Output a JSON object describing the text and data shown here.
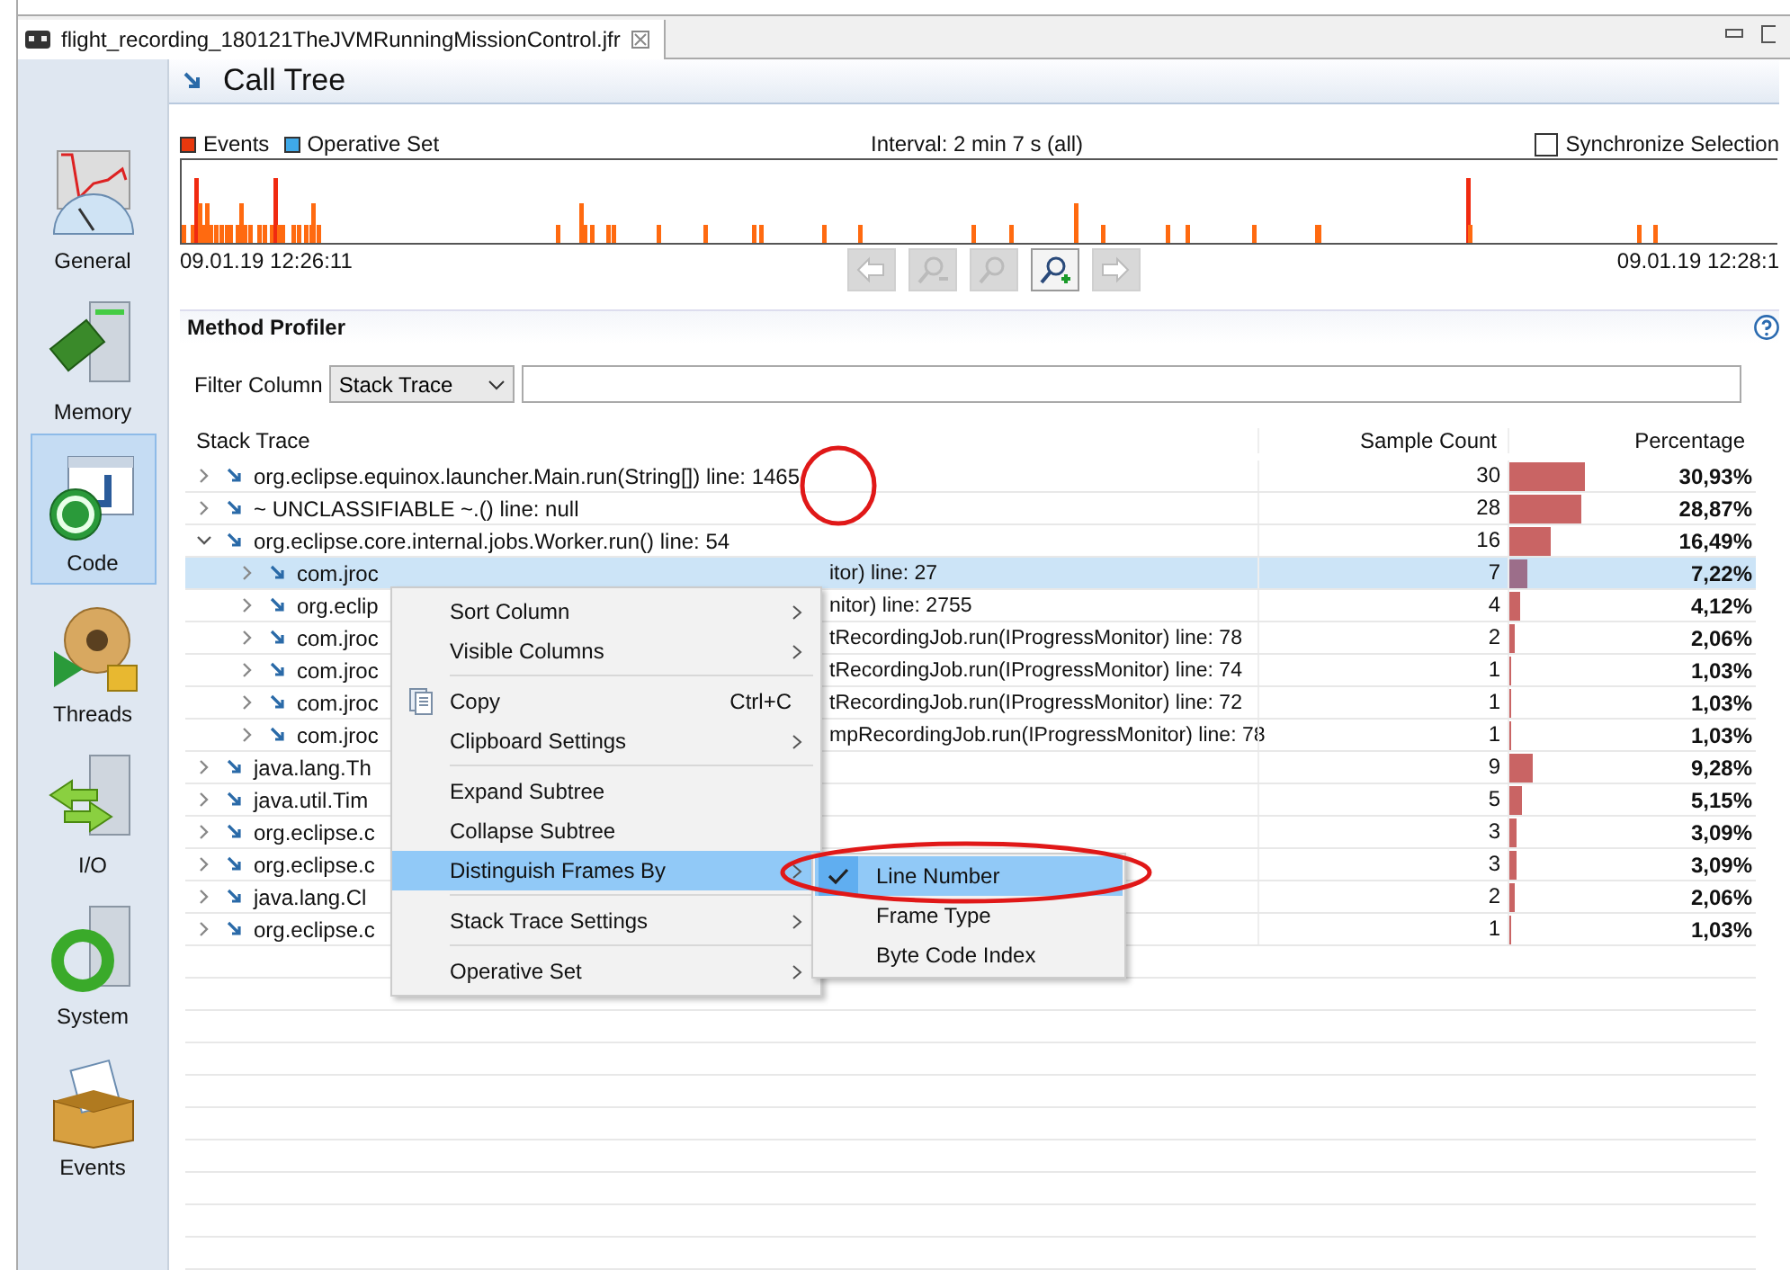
{
  "editor_tab": {
    "title": "flight_recording_180121TheJVMRunningMissionControl.jfr"
  },
  "sidebar": {
    "items": [
      {
        "label": "General",
        "selected": false
      },
      {
        "label": "Memory",
        "selected": false
      },
      {
        "label": "Code",
        "selected": true
      },
      {
        "label": "Threads",
        "selected": false
      },
      {
        "label": "I/O",
        "selected": false
      },
      {
        "label": "System",
        "selected": false
      },
      {
        "label": "Events",
        "selected": false
      }
    ]
  },
  "page": {
    "title": "Call Tree"
  },
  "timeline": {
    "legend": [
      {
        "label": "Events",
        "color": "#e8380d"
      },
      {
        "label": "Operative Set",
        "color": "#3fa9e8"
      }
    ],
    "interval": "Interval: 2 min 7 s (all)",
    "synchronize": {
      "label": "Synchronize Selection",
      "checked": false
    },
    "start_time": "09.01.19 12:26:11",
    "end_time": "09.01.19 12:28:1",
    "nav_buttons": [
      {
        "disabled": true
      },
      {
        "disabled": true
      },
      {
        "disabled": true
      },
      {
        "disabled": false
      },
      {
        "disabled": true
      }
    ]
  },
  "method_profiler": {
    "title": "Method Profiler",
    "filter_label": "Filter Column",
    "filter_value": "Stack Trace",
    "columns": [
      "Stack Trace",
      "Sample Count",
      "Percentage"
    ],
    "rows": [
      {
        "label": "org.eclipse.equinox.launcher.Main.run(String[]) line: 1465",
        "count": "30",
        "percentage": "30,93%",
        "level": 0.3093,
        "expanded": false,
        "selected": false
      },
      {
        "label": "~ UNCLASSIFIABLE ~.() line: null",
        "count": "28",
        "percentage": "28,87%",
        "level": 0.2887,
        "expanded": false,
        "selected": false
      },
      {
        "label": "org.eclipse.core.internal.jobs.Worker.run() line: 54",
        "count": "16",
        "percentage": "16,49%",
        "level": 0.1649,
        "expanded": true,
        "selected": false,
        "children": [
          {
            "label": "com.jroc",
            "tail": "itor) line: 27",
            "count": "7",
            "percentage": "7,22%",
            "level": 0.0722,
            "expanded": false,
            "selected": true
          },
          {
            "label": "org.eclip",
            "tail": "nitor) line: 2755",
            "count": "4",
            "percentage": "4,12%",
            "level": 0.0412,
            "expanded": false,
            "selected": false
          },
          {
            "label": "com.jroc",
            "tail": "tRecordingJob.run(IProgressMonitor) line: 78",
            "count": "2",
            "percentage": "2,06%",
            "level": 0.0206,
            "expanded": false,
            "selected": false
          },
          {
            "label": "com.jroc",
            "tail": "tRecordingJob.run(IProgressMonitor) line: 74",
            "count": "1",
            "percentage": "1,03%",
            "level": 0.0103,
            "expanded": false,
            "selected": false
          },
          {
            "label": "com.jroc",
            "tail": "tRecordingJob.run(IProgressMonitor) line: 72",
            "count": "1",
            "percentage": "1,03%",
            "level": 0.0103,
            "expanded": false,
            "selected": false
          },
          {
            "label": "com.jroc",
            "tail": "mpRecordingJob.run(IProgressMonitor) line: 78",
            "count": "1",
            "percentage": "1,03%",
            "level": 0.0103,
            "expanded": false,
            "selected": false
          }
        ]
      },
      {
        "label": "java.lang.Th",
        "count": "9",
        "percentage": "9,28%",
        "level": 0.0928,
        "expanded": false,
        "selected": false
      },
      {
        "label": "java.util.Tim",
        "count": "5",
        "percentage": "5,15%",
        "level": 0.0515,
        "expanded": false,
        "selected": false
      },
      {
        "label": "org.eclipse.c",
        "count": "3",
        "percentage": "3,09%",
        "level": 0.0309,
        "expanded": false,
        "selected": false
      },
      {
        "label": "org.eclipse.c",
        "count": "3",
        "percentage": "3,09%",
        "level": 0.0309,
        "expanded": false,
        "selected": false
      },
      {
        "label": "java.lang.Cl",
        "count": "2",
        "percentage": "2,06%",
        "level": 0.0206,
        "expanded": false,
        "selected": false
      },
      {
        "label": "org.eclipse.c",
        "count": "1",
        "percentage": "1,03%",
        "level": 0.0103,
        "expanded": false,
        "selected": false
      }
    ]
  },
  "context_menu": {
    "items": [
      {
        "label": "Sort Column",
        "kind": "submenu",
        "selected": false,
        "separator_before": false
      },
      {
        "label": "Visible Columns",
        "kind": "submenu",
        "selected": false,
        "separator_before": false
      },
      {
        "label": "Copy",
        "kind": "command",
        "shortcut": "Ctrl+C",
        "icon": true,
        "selected": false,
        "separator_before": true
      },
      {
        "label": "Clipboard Settings",
        "kind": "submenu",
        "selected": false,
        "separator_before": false
      },
      {
        "label": "Expand Subtree",
        "kind": "command",
        "selected": false,
        "separator_before": true
      },
      {
        "label": "Collapse Subtree",
        "kind": "command",
        "selected": false,
        "separator_before": false
      },
      {
        "label": "Distinguish Frames By",
        "kind": "submenu",
        "selected": true,
        "separator_before": false
      },
      {
        "label": "Stack Trace Settings",
        "kind": "submenu",
        "selected": false,
        "separator_before": true
      },
      {
        "label": "Operative Set",
        "kind": "submenu",
        "selected": false,
        "separator_before": true
      }
    ]
  },
  "submenu": {
    "items": [
      {
        "label": "Line Number",
        "checked": true,
        "selected": true
      },
      {
        "label": "Frame Type",
        "checked": false,
        "selected": false
      },
      {
        "label": "Byte Code Index",
        "checked": false,
        "selected": false
      }
    ]
  }
}
